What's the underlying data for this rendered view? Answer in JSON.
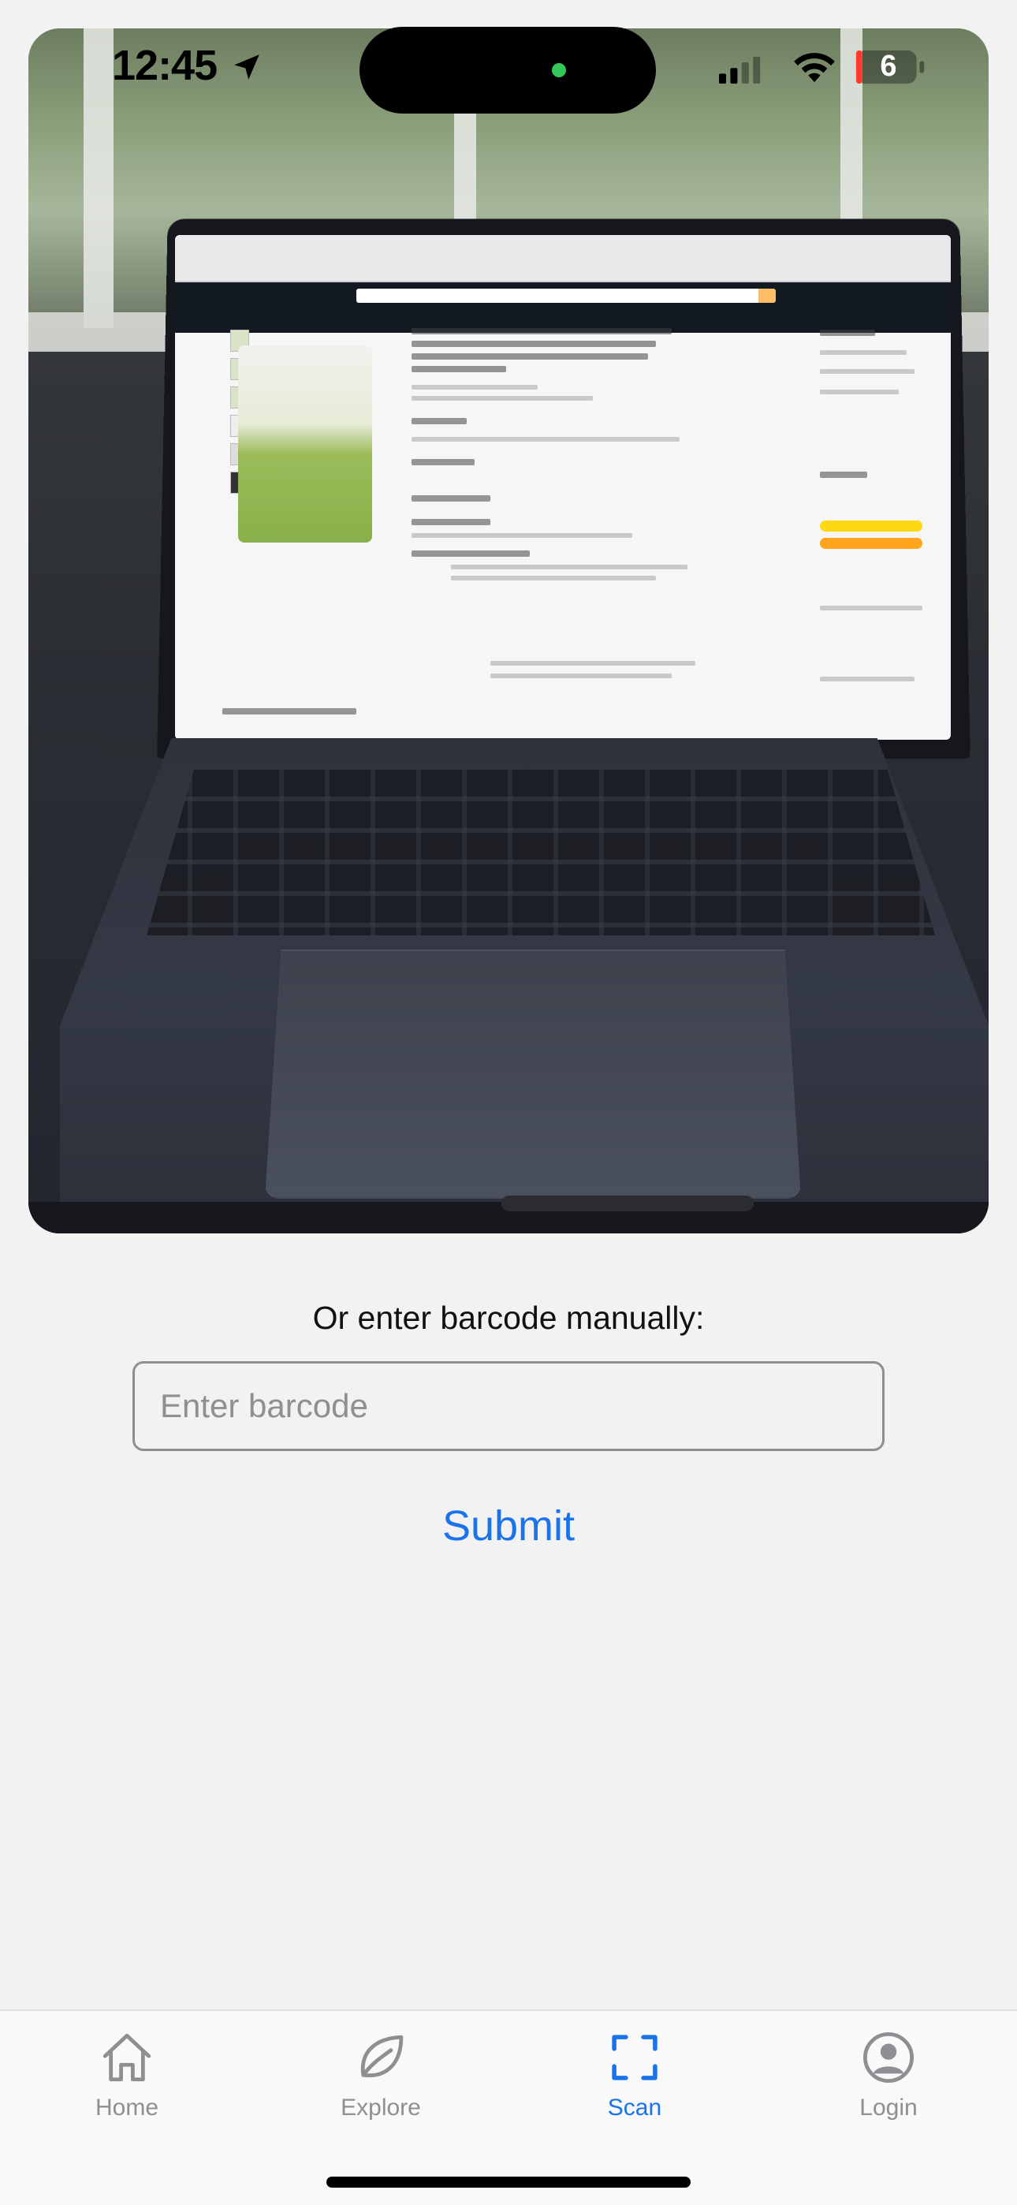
{
  "status_bar": {
    "time": "12:45",
    "battery_level": "6",
    "icons": [
      "location-arrow-icon",
      "signal-icon",
      "wifi-icon",
      "battery-icon"
    ]
  },
  "camera_preview": {
    "icon": "camera-preview"
  },
  "manual_entry": {
    "label": "Or enter barcode manually:",
    "input_placeholder": "Enter barcode",
    "input_value": "",
    "submit_label": "Submit"
  },
  "tab_bar": {
    "active_tab": "Scan",
    "tabs": [
      {
        "label": "Home",
        "icon": "home-icon"
      },
      {
        "label": "Explore",
        "icon": "leaf-icon"
      },
      {
        "label": "Scan",
        "icon": "scan-icon"
      },
      {
        "label": "Login",
        "icon": "user-circle-icon"
      }
    ]
  },
  "colors": {
    "accent": "#1a73e8",
    "inactive": "#8e8e93",
    "background": "#f2f2f2"
  }
}
